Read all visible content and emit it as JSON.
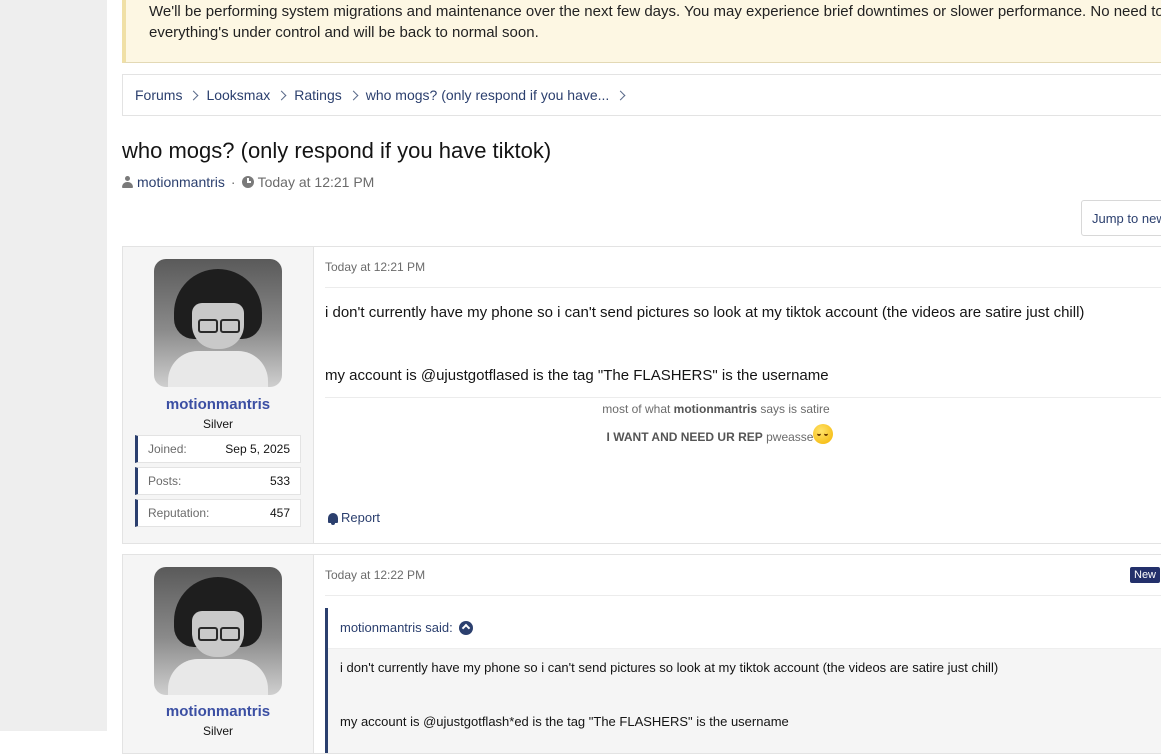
{
  "notice": {
    "line1": "We'll be performing system migrations and maintenance over the next few days. You may experience brief downtimes or slower performance. No need to pa",
    "line2": "everything's under control and will be back to normal soon."
  },
  "breadcrumb": [
    "Forums",
    "Looksmax",
    "Ratings",
    "who mogs? (only respond if you have..."
  ],
  "thread": {
    "title": "who mogs? (only respond if you have tiktok)",
    "author": "motionmantris",
    "separator": "·",
    "time": "Today at 12:21 PM"
  },
  "jump_button": "Jump to new",
  "posts": [
    {
      "user": {
        "name": "motionmantris",
        "title": "Silver",
        "stats": [
          {
            "label": "Joined:",
            "value": "Sep 5, 2025"
          },
          {
            "label": "Posts:",
            "value": "533"
          },
          {
            "label": "Reputation:",
            "value": "457"
          }
        ]
      },
      "date": "Today at 12:21 PM",
      "body_line1": "i don't currently have my phone so i can't send pictures so look at my tiktok account (the videos are satire just chill)",
      "body_line2": "my account is @ujustgotflased is the tag \"The FLASHERS\" is the username",
      "signature": {
        "pre": "most of what ",
        "name": "motionmantris",
        "post": " says is satire",
        "bold2": "I WANT AND NEED UR REP",
        "tail": " pweasse"
      },
      "report_label": "Report"
    },
    {
      "user": {
        "name": "motionmantris",
        "title": "Silver"
      },
      "date": "Today at 12:22 PM",
      "badge": "New",
      "quote": {
        "author": "motionmantris said:",
        "line1": "i don't currently have my phone so i can't send pictures so look at my tiktok account (the videos are satire just chill)",
        "line2": "my account is @ujustgotflash*ed is the tag \"The FLASHERS\" is the username"
      }
    }
  ],
  "colors": {
    "link": "#2b3f6e",
    "username": "#3b4fa3",
    "notice_bg": "#fdf7e3",
    "badge_bg": "#23306b"
  }
}
